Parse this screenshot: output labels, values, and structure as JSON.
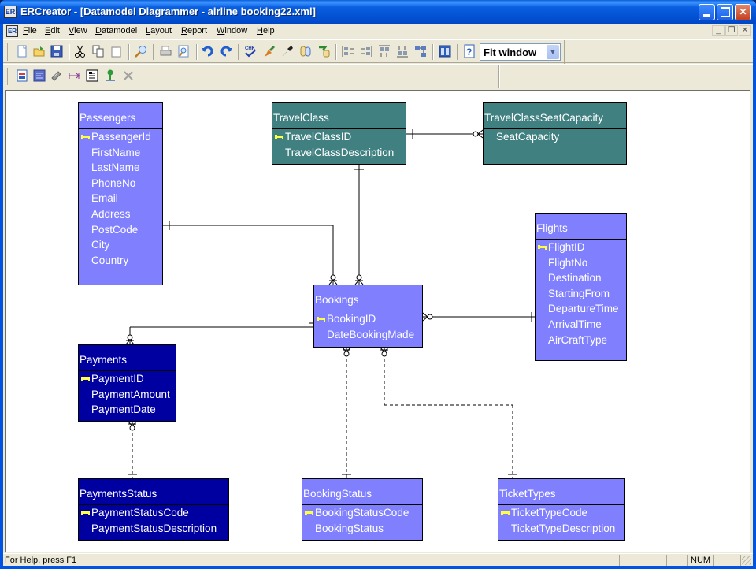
{
  "window": {
    "title": "ERCreator - [Datamodel Diagrammer - airline booking22.xml]",
    "app_icon": "app-icon",
    "controls": [
      "minimize",
      "maximize",
      "close"
    ]
  },
  "menubar": {
    "items": [
      {
        "label": "File",
        "access": "F"
      },
      {
        "label": "Edit",
        "access": "E"
      },
      {
        "label": "View",
        "access": "V"
      },
      {
        "label": "Datamodel",
        "access": "D"
      },
      {
        "label": "Layout",
        "access": "L"
      },
      {
        "label": "Report",
        "access": "R"
      },
      {
        "label": "Window",
        "access": "W"
      },
      {
        "label": "Help",
        "access": "H"
      }
    ],
    "mdi_controls": [
      "minimize",
      "restore",
      "close"
    ]
  },
  "toolbar1": {
    "buttons": [
      "new-icon",
      "open-icon",
      "save-icon",
      "cut-icon",
      "copy-icon",
      "paste-icon",
      "find-icon",
      "print-icon",
      "print-preview-icon",
      "undo-icon",
      "redo-icon",
      "check-model-icon",
      "generate-icon",
      "connect-icon",
      "compare-icon",
      "import-icon",
      "align-left-icon",
      "align-right-icon",
      "align-top-icon",
      "align-bottom-icon",
      "auto-layout-icon",
      "properties-icon",
      "help-icon"
    ],
    "zoom": {
      "value": "Fit window"
    }
  },
  "toolbar2": {
    "buttons": [
      "add-entity-icon",
      "add-attribute-icon",
      "edit-icon",
      "add-relationship-icon",
      "add-note-icon",
      "add-marker-icon",
      "delete-icon"
    ]
  },
  "diagram": {
    "entities": [
      {
        "name": "Passengers",
        "style": "light",
        "attributes": [
          {
            "name": "PassengerId",
            "key": true
          },
          {
            "name": "FirstName"
          },
          {
            "name": "LastName"
          },
          {
            "name": "PhoneNo"
          },
          {
            "name": "Email"
          },
          {
            "name": "Address"
          },
          {
            "name": "PostCode"
          },
          {
            "name": "City"
          },
          {
            "name": "Country"
          }
        ]
      },
      {
        "name": "TravelClass",
        "style": "teal",
        "attributes": [
          {
            "name": "TravelClassID",
            "key": true
          },
          {
            "name": "TravelClassDescription"
          }
        ]
      },
      {
        "name": "TravelClassSeatCapacity",
        "style": "teal",
        "attributes": [
          {
            "name": "SeatCapacity"
          }
        ]
      },
      {
        "name": "Flights",
        "style": "light",
        "attributes": [
          {
            "name": "FlightID",
            "key": true
          },
          {
            "name": "FlightNo"
          },
          {
            "name": "Destination"
          },
          {
            "name": "StartingFrom"
          },
          {
            "name": "DepartureTime"
          },
          {
            "name": "ArrivalTime"
          },
          {
            "name": "AirCraftType"
          }
        ]
      },
      {
        "name": "Bookings",
        "style": "light",
        "attributes": [
          {
            "name": "BookingID",
            "key": true
          },
          {
            "name": "DateBookingMade"
          }
        ]
      },
      {
        "name": "Payments",
        "style": "dark",
        "attributes": [
          {
            "name": "PaymentID",
            "key": true
          },
          {
            "name": "PaymentAmount"
          },
          {
            "name": "PaymentDate"
          }
        ]
      },
      {
        "name": "PaymentsStatus",
        "style": "dark",
        "attributes": [
          {
            "name": "PaymentStatusCode",
            "key": true
          },
          {
            "name": "PaymentStatusDescription"
          }
        ]
      },
      {
        "name": "BookingStatus",
        "style": "light",
        "attributes": [
          {
            "name": "BookingStatusCode",
            "key": true
          },
          {
            "name": "BookingStatus"
          }
        ]
      },
      {
        "name": "TicketTypes",
        "style": "light",
        "attributes": [
          {
            "name": "TicketTypeCode",
            "key": true
          },
          {
            "name": "TicketTypeDescription"
          }
        ]
      }
    ],
    "relationships": [
      {
        "from": "TravelClass",
        "to": "TravelClassSeatCapacity",
        "type": "one-to-zero-or-many",
        "identifying": true
      },
      {
        "from": "TravelClass",
        "to": "Bookings",
        "type": "one-to-one-or-many",
        "identifying": true
      },
      {
        "from": "Passengers",
        "to": "Bookings",
        "type": "one-to-one-or-many",
        "identifying": true
      },
      {
        "from": "Flights",
        "to": "Bookings",
        "type": "one-to-zero-or-many",
        "identifying": true
      },
      {
        "from": "Bookings",
        "to": "Payments",
        "type": "one-or-many-to-zero-or-many",
        "identifying": true
      },
      {
        "from": "PaymentsStatus",
        "to": "Payments",
        "type": "one-to-zero-or-many",
        "identifying": false
      },
      {
        "from": "BookingStatus",
        "to": "Bookings",
        "type": "one-to-zero-or-many",
        "identifying": false
      },
      {
        "from": "TicketTypes",
        "to": "Bookings",
        "type": "one-to-zero-or-many",
        "identifying": false
      }
    ],
    "colors": {
      "light": "#8080ff",
      "teal": "#408080",
      "dark": "#0000a0",
      "key": "#ffff40"
    }
  },
  "statusbar": {
    "help_text": "For Help, press F1",
    "num_indicator": "NUM"
  }
}
